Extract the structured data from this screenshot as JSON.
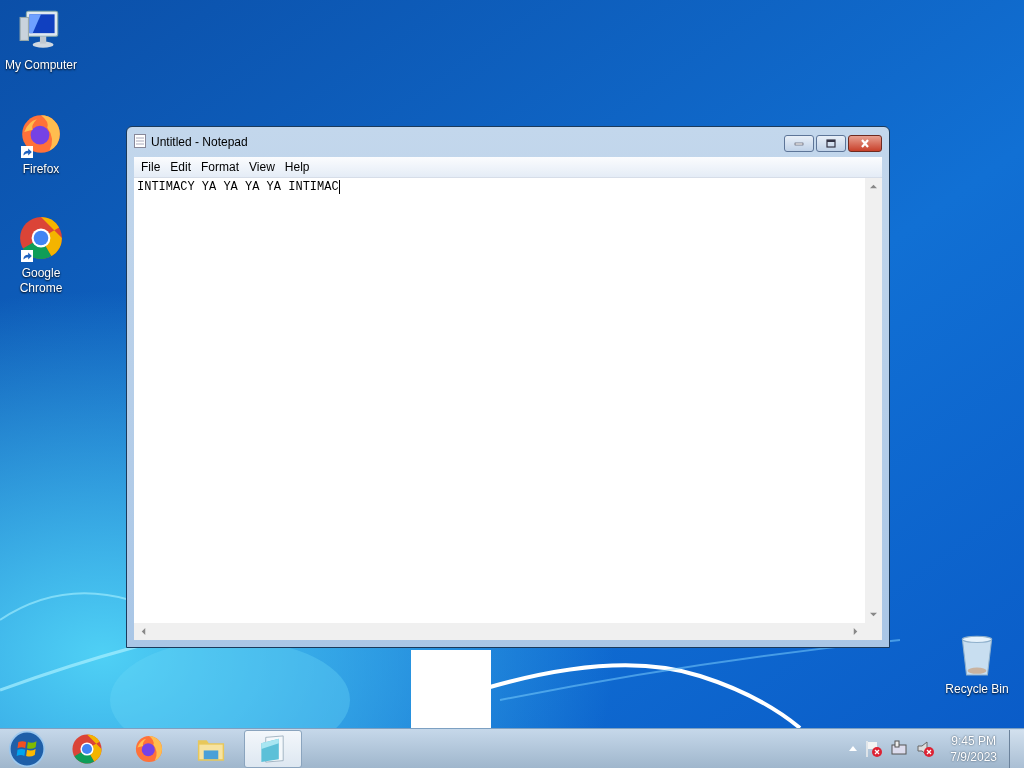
{
  "desktop_icons": [
    {
      "label": "My Computer",
      "kind": "computer",
      "shortcut": false
    },
    {
      "label": "Firefox",
      "kind": "firefox",
      "shortcut": true
    },
    {
      "label": "Google Chrome",
      "kind": "chrome",
      "shortcut": true
    },
    {
      "label": "Recycle Bin",
      "kind": "bin",
      "shortcut": false
    }
  ],
  "window": {
    "title": "Untitled - Notepad",
    "menu": [
      "File",
      "Edit",
      "Format",
      "View",
      "Help"
    ],
    "text": "INTIMACY YA YA YA YA INTIMAC"
  },
  "taskbar": {
    "items": [
      {
        "kind": "chrome",
        "selected": false
      },
      {
        "kind": "firefox",
        "selected": false
      },
      {
        "kind": "folder",
        "selected": false
      },
      {
        "kind": "notepad",
        "selected": true
      }
    ],
    "clock": {
      "time": "9:45 PM",
      "date": "7/9/2023"
    }
  }
}
